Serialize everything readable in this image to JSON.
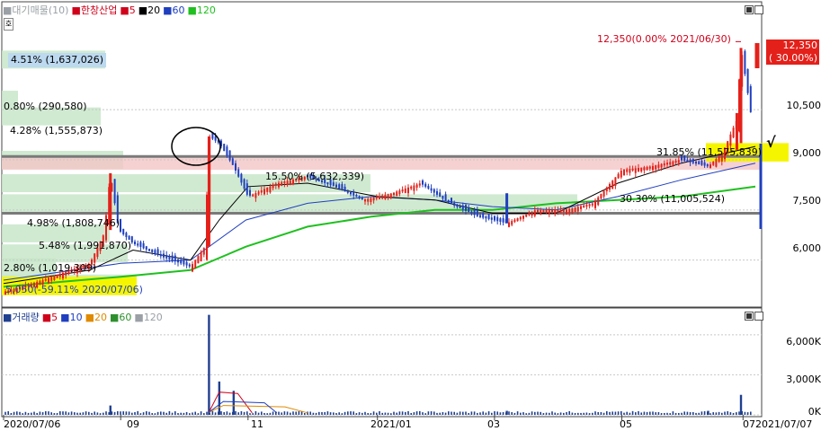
{
  "price_legend": {
    "items": [
      {
        "text": "■대기매물(10)",
        "color": "#9aa0a6"
      },
      {
        "text": "■한창산업",
        "color": "#d0021b"
      },
      {
        "text": "■5",
        "color": "#d0021b"
      },
      {
        "text": "■20",
        "color": "#000000"
      },
      {
        "text": "■60",
        "color": "#1f3fbf"
      },
      {
        "text": "■120",
        "color": "#1fc01f"
      }
    ]
  },
  "volume_legend": {
    "items": [
      {
        "text": "■거래량",
        "color": "#1f3f8f"
      },
      {
        "text": "■5",
        "color": "#d0021b"
      },
      {
        "text": "■10",
        "color": "#1f3fbf"
      },
      {
        "text": "■20",
        "color": "#e08a00"
      },
      {
        "text": "■60",
        "color": "#2f8f2f"
      },
      {
        "text": "■120",
        "color": "#9aa0a6"
      }
    ]
  },
  "price_axis": {
    "ticks": [
      "10,500",
      "9,000",
      "7,500",
      "6,000"
    ]
  },
  "volume_axis": {
    "ticks": [
      "6,000K",
      "3,000K",
      "0K"
    ]
  },
  "time_axis": {
    "labels": [
      "2020/07/06",
      "09",
      "11",
      "2021/01",
      "03",
      "05",
      "07",
      "2021/07/07"
    ]
  },
  "annotations": {
    "high": "12,350(0.00% 2021/06/30)",
    "low": "5,050(-59.11% 2020/07/06)",
    "current_price": "12,350",
    "current_change": "( 30.00%)",
    "check_mark": "√"
  },
  "profile_labels": [
    "4.51% (1,637,026)",
    "0.80% (290,580)",
    "4.28% (1,555,873)",
    "15.50% (5,632,339)",
    "4.98% (1,808,746)",
    "5.48% (1,991,870)",
    "2.80% (1,019,309)",
    "31.85% (11,575,839)",
    "30.30% (11,005,524)"
  ],
  "colors": {
    "up": "#e4201a",
    "down": "#1f3fbf",
    "ma5": "#d0021b",
    "ma20": "#000000",
    "ma60": "#1f3fbf",
    "ma120": "#1fc01f",
    "profile": "#c8e6c9",
    "band": "#f4c6c6",
    "highlight": "#f5f500"
  },
  "chart_data": {
    "type": "candlestick",
    "title": "한창산업",
    "x_range": [
      "2020/07/06",
      "2021/07/07"
    ],
    "ylim": [
      4700,
      13300
    ],
    "yticks": [
      6000,
      7500,
      9000,
      10500
    ],
    "price_points": [
      [
        "2020/07/06",
        5050
      ],
      [
        "2020/07/20",
        5300
      ],
      [
        "2020/08/03",
        5600
      ],
      [
        "2020/08/17",
        5900
      ],
      [
        "2020/08/24",
        6800
      ],
      [
        "2020/08/27",
        8600
      ],
      [
        "2020/08/31",
        6900
      ],
      [
        "2020/09/07",
        6500
      ],
      [
        "2020/09/21",
        6100
      ],
      [
        "2020/10/05",
        5800
      ],
      [
        "2020/10/12",
        6400
      ],
      [
        "2020/10/14",
        9700
      ],
      [
        "2020/10/19",
        9500
      ],
      [
        "2020/10/26",
        8800
      ],
      [
        "2020/11/02",
        7900
      ],
      [
        "2020/11/16",
        8300
      ],
      [
        "2020/11/30",
        8500
      ],
      [
        "2020/12/14",
        8200
      ],
      [
        "2020/12/28",
        7800
      ],
      [
        "2021/01/11",
        8000
      ],
      [
        "2021/01/25",
        8300
      ],
      [
        "2021/02/08",
        7700
      ],
      [
        "2021/02/22",
        7300
      ],
      [
        "2021/03/08",
        7100
      ],
      [
        "2021/03/22",
        7500
      ],
      [
        "2021/04/05",
        7500
      ],
      [
        "2021/04/19",
        7700
      ],
      [
        "2021/05/03",
        8700
      ],
      [
        "2021/05/17",
        8800
      ],
      [
        "2021/05/31",
        9000
      ],
      [
        "2021/06/14",
        8800
      ],
      [
        "2021/06/21",
        9200
      ],
      [
        "2021/06/28",
        10200
      ],
      [
        "2021/06/30",
        12350
      ],
      [
        "2021/07/07",
        9500
      ]
    ],
    "ma20_points": [
      [
        "2020/07/06",
        5300
      ],
      [
        "2020/08/17",
        5700
      ],
      [
        "2020/09/07",
        6300
      ],
      [
        "2020/10/05",
        6000
      ],
      [
        "2020/10/19",
        7200
      ],
      [
        "2020/11/02",
        8200
      ],
      [
        "2020/12/01",
        8300
      ],
      [
        "2021/01/04",
        7900
      ],
      [
        "2021/02/01",
        7800
      ],
      [
        "2021/03/01",
        7400
      ],
      [
        "2021/04/01",
        7400
      ],
      [
        "2021/05/01",
        8300
      ],
      [
        "2021/06/01",
        8900
      ],
      [
        "2021/07/07",
        9400
      ]
    ],
    "ma60_points": [
      [
        "2020/07/06",
        5400
      ],
      [
        "2020/09/01",
        5900
      ],
      [
        "2020/10/05",
        6000
      ],
      [
        "2020/11/01",
        7200
      ],
      [
        "2020/12/01",
        7700
      ],
      [
        "2021/01/01",
        7900
      ],
      [
        "2021/02/01",
        7800
      ],
      [
        "2021/03/01",
        7600
      ],
      [
        "2021/04/01",
        7500
      ],
      [
        "2021/05/01",
        7900
      ],
      [
        "2021/06/01",
        8400
      ],
      [
        "2021/07/07",
        8900
      ]
    ],
    "ma120_points": [
      [
        "2020/07/06",
        5200
      ],
      [
        "2020/09/01",
        5500
      ],
      [
        "2020/10/05",
        5700
      ],
      [
        "2020/11/01",
        6400
      ],
      [
        "2020/12/01",
        7000
      ],
      [
        "2021/01/01",
        7300
      ],
      [
        "2021/02/01",
        7500
      ],
      [
        "2021/03/01",
        7500
      ],
      [
        "2021/04/01",
        7700
      ],
      [
        "2021/05/01",
        7800
      ],
      [
        "2021/06/01",
        7900
      ],
      [
        "2021/07/07",
        8200
      ]
    ],
    "horizontal_lines": [
      9100,
      7400
    ],
    "highlight_band": [
      8700,
      9100
    ],
    "volume_axis": {
      "ylim": [
        0,
        7000
      ],
      "unit": "K",
      "ticks": [
        0,
        3000,
        6000
      ]
    },
    "volume_spikes": [
      [
        "2020/08/27",
        700
      ],
      [
        "2020/10/14",
        7500
      ],
      [
        "2020/10/19",
        2500
      ],
      [
        "2020/10/26",
        1800
      ],
      [
        "2021/03/08",
        300
      ],
      [
        "2021/06/14",
        300
      ],
      [
        "2021/06/30",
        1500
      ]
    ]
  }
}
